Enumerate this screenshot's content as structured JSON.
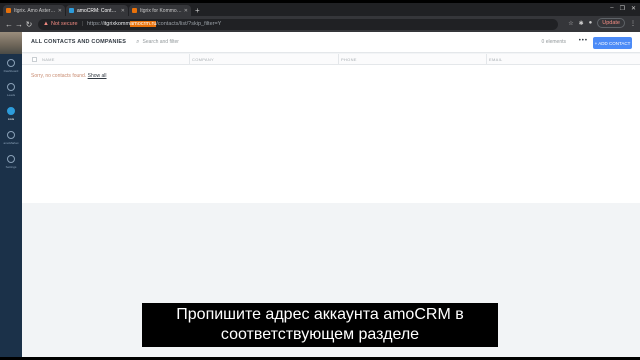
{
  "browser": {
    "tabs": [
      {
        "label": "Itgrix. Amo Asterisk Conn",
        "color": "#e8710a",
        "active": false
      },
      {
        "label": "amoCRM: Contacts, itgrix",
        "color": "#2d9cdb",
        "active": true
      },
      {
        "label": "Itgrix for Kommo and Ast",
        "color": "#e8710a",
        "active": false
      }
    ],
    "new_tab": "+",
    "window_controls": [
      "‒",
      "❐",
      "✕"
    ],
    "nav": {
      "back": "←",
      "forward": "→",
      "reload": "↻"
    },
    "address": {
      "warning_icon": "warning-icon",
      "not_secure": "Not secure",
      "url_prefix": "https://",
      "url_host": "itgrixkomm",
      "url_highlight": "amocrm.ru",
      "url_path": "/contacts/list/?skip_filter=Y"
    },
    "update_label": "Update"
  },
  "sidebar": {
    "items": [
      {
        "label": "Dashboard",
        "icon": "dashboard-icon",
        "active": false
      },
      {
        "label": "Leads",
        "icon": "leads-icon",
        "active": false
      },
      {
        "label": "Lists",
        "icon": "lists-icon",
        "active": true
      },
      {
        "label": "amoMarket",
        "icon": "market-icon",
        "active": false
      },
      {
        "label": "Settings",
        "icon": "settings-icon",
        "active": false
      }
    ]
  },
  "header": {
    "title": "ALL CONTACTS AND COMPANIES",
    "search_placeholder": "Search and filter",
    "count": "0 elements",
    "more": "•••",
    "add_button": "+ ADD CONTACT"
  },
  "table": {
    "columns": [
      "NAME",
      "COMPANY",
      "PHONE",
      "EMAIL"
    ],
    "empty_text": "Sorry, no contacts found.",
    "show_all": "Show all"
  },
  "subtitle": {
    "line1": "Пропишите адрес аккаунта amoCRM в",
    "line2": "соответствующем разделе"
  },
  "colors": {
    "sidebar": "#1b3149",
    "accent": "#4c8bf7",
    "url_highlight": "#e8710a"
  }
}
